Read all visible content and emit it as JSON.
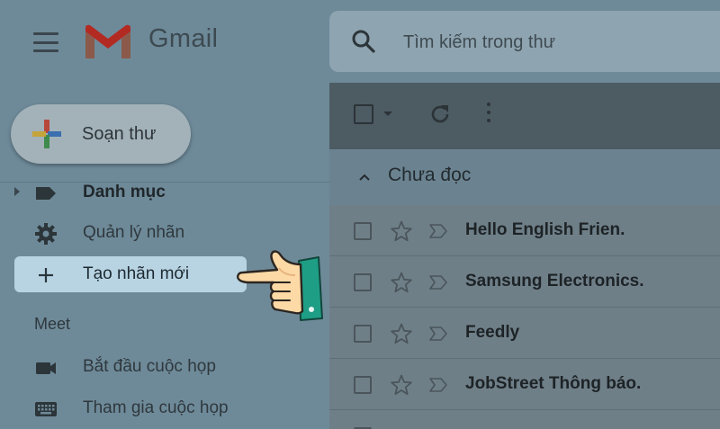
{
  "header": {
    "app_name": "Gmail",
    "search_placeholder": "Tìm kiếm trong thư"
  },
  "sidebar": {
    "compose_label": "Soạn thư",
    "items": [
      {
        "label": "Danh mục",
        "icon": "label-icon"
      },
      {
        "label": "Quản lý nhãn",
        "icon": "gear-icon"
      },
      {
        "label": "Tạo nhãn mới",
        "icon": "plus-icon"
      }
    ],
    "meet": {
      "title": "Meet",
      "items": [
        {
          "label": "Bắt đầu cuộc họp",
          "icon": "video-camera-icon"
        },
        {
          "label": "Tham gia cuộc họp",
          "icon": "keyboard-icon"
        }
      ]
    }
  },
  "main": {
    "section_title": "Chưa đọc",
    "emails": [
      {
        "sender": "Hello English Frien."
      },
      {
        "sender": "Samsung Electronics."
      },
      {
        "sender": "Feedly"
      },
      {
        "sender": "JobStreet Thông báo."
      }
    ]
  },
  "colors": {
    "overlay": "#6e8a99",
    "active_item": "#b8d4e3",
    "gmail_red": "#c5221f",
    "cuff": "#1f9e86",
    "hand": "#fcd9a5"
  }
}
